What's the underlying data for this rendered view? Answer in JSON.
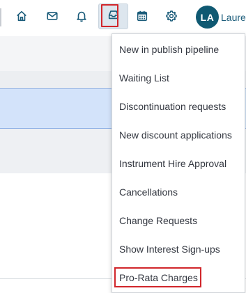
{
  "header": {
    "icons": {
      "home": "home-icon",
      "mail": "mail-icon",
      "notifications": "bell-icon",
      "inbox": "inbox-tray-icon",
      "calendar": "calendar-icon",
      "settings": "gear-icon"
    },
    "user": {
      "initials": "LA",
      "name": "Laure"
    }
  },
  "inbox_menu": {
    "items": [
      {
        "label": "New in publish pipeline"
      },
      {
        "label": "Waiting List"
      },
      {
        "label": "Discontinuation requests"
      },
      {
        "label": "New discount applications"
      },
      {
        "label": "Instrument Hire Approval"
      },
      {
        "label": "Cancellations"
      },
      {
        "label": "Change Requests"
      },
      {
        "label": "Show Interest Sign-ups"
      },
      {
        "label": "Pro-Rata Charges"
      }
    ]
  },
  "colors": {
    "accent": "#1b5c7a",
    "avatar_bg": "#0f5972",
    "highlight_red": "#d1262b",
    "selected_row": "#d3e3fa",
    "active_button_bg": "#dde6ee"
  }
}
